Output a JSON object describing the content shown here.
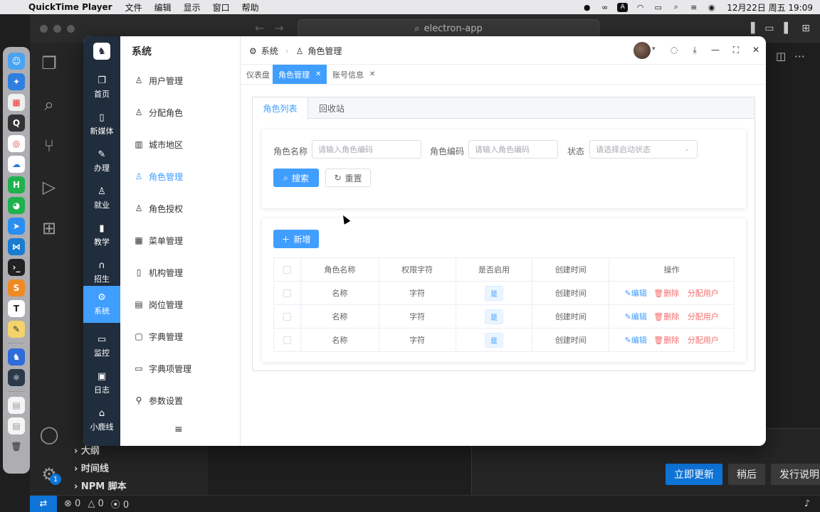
{
  "menubar": {
    "app_name": "QuickTime Player",
    "items": [
      "文件",
      "编辑",
      "显示",
      "窗口",
      "帮助"
    ],
    "clock": "12月22日 周五  19:09",
    "input_method": "A"
  },
  "vscode": {
    "search_text": "electron-app",
    "sidebar_rows": [
      "大纲",
      "时间线",
      "NPM 脚本"
    ],
    "source_control_badge": "1",
    "status": {
      "errors": "0",
      "warnings": "0",
      "ports": "0"
    },
    "notification": {
      "primary": "立即更新",
      "later": "稍后",
      "notes": "发行说明"
    }
  },
  "app": {
    "nav": [
      {
        "label": "首页",
        "icon": "home-doc-icon"
      },
      {
        "label": "新媒体",
        "icon": "tablet-icon"
      },
      {
        "label": "办理",
        "icon": "pen-icon"
      },
      {
        "label": "就业",
        "icon": "person-pin-icon"
      },
      {
        "label": "教学",
        "icon": "mic-icon"
      },
      {
        "label": "招生",
        "icon": "headset-icon"
      },
      {
        "label": "系统",
        "icon": "gear-icon"
      },
      {
        "label": "监控",
        "icon": "monitor-icon"
      },
      {
        "label": "日志",
        "icon": "log-icon"
      },
      {
        "label": "小鹿线",
        "icon": "house-icon"
      }
    ],
    "active_nav": "系统",
    "menu_title": "系统",
    "menu": [
      {
        "label": "用户管理",
        "icon": "user-icon"
      },
      {
        "label": "分配角色",
        "icon": "user-icon"
      },
      {
        "label": "城市地区",
        "icon": "building-icon"
      },
      {
        "label": "角色管理",
        "icon": "user-icon"
      },
      {
        "label": "角色授权",
        "icon": "user-icon"
      },
      {
        "label": "菜单管理",
        "icon": "grid-icon"
      },
      {
        "label": "机构管理",
        "icon": "org-icon"
      },
      {
        "label": "岗位管理",
        "icon": "post-icon"
      },
      {
        "label": "字典管理",
        "icon": "dict-icon"
      },
      {
        "label": "字典项管理",
        "icon": "card-icon"
      },
      {
        "label": "参数设置",
        "icon": "settings-icon"
      }
    ],
    "active_menu": "角色管理",
    "breadcrumb": [
      "系统",
      "角色管理"
    ],
    "tags": [
      {
        "label": "仪表盘",
        "closable": false,
        "active": false
      },
      {
        "label": "角色管理",
        "closable": true,
        "active": true
      },
      {
        "label": "账号信息",
        "closable": true,
        "active": false
      }
    ],
    "panel_tabs": [
      "角色列表",
      "回收站"
    ],
    "search": {
      "role_name_label": "角色名称",
      "role_name_placeholder": "请输入角色编码",
      "role_code_label": "角色编码",
      "role_code_placeholder": "请输入角色编码",
      "status_label": "状态",
      "status_placeholder": "请选择启动状态",
      "search_btn": "搜索",
      "reset_btn": "重置"
    },
    "add_btn": "新增",
    "table": {
      "headers": [
        "角色名称",
        "权限字符",
        "是否启用",
        "创建时间",
        "操作"
      ],
      "rows": [
        {
          "name": "名称",
          "perm": "字符",
          "enabled": "是",
          "created": "创建时间"
        },
        {
          "name": "名称",
          "perm": "字符",
          "enabled": "是",
          "created": "创建时间"
        },
        {
          "name": "名称",
          "perm": "字符",
          "enabled": "是",
          "created": "创建时间"
        }
      ],
      "ops": {
        "edit": "编辑",
        "delete": "删除",
        "assign": "分配用户"
      }
    }
  }
}
